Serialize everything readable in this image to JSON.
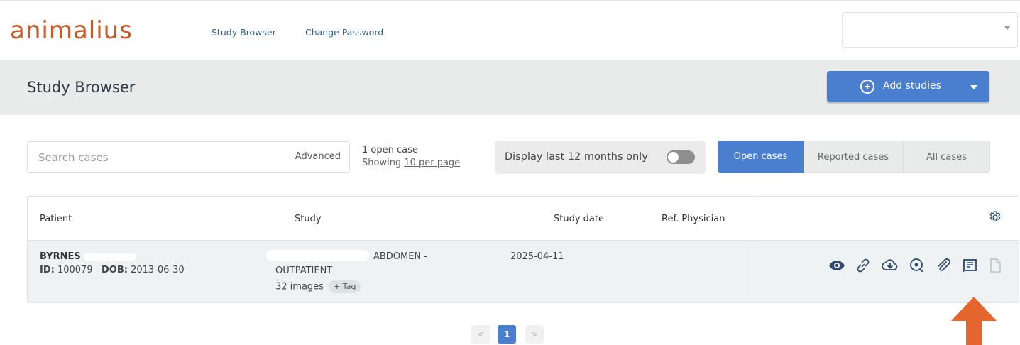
{
  "nav": {
    "logo": "animalius",
    "links": [
      "Study Browser",
      "Change Password"
    ]
  },
  "header": {
    "title": "Study Browser",
    "add_button": "Add studies"
  },
  "search": {
    "placeholder": "Search cases",
    "advanced": "Advanced"
  },
  "summary": {
    "count": "1 open case",
    "showing": "Showing ",
    "per_page": "10 per page"
  },
  "filter": {
    "toggle_label": "Display last 12 months only",
    "toggle_on": false
  },
  "segments": [
    "Open cases",
    "Reported cases",
    "All cases"
  ],
  "table": {
    "headers": [
      "Patient",
      "Study",
      "Study date",
      "Ref. Physician"
    ],
    "rows": [
      {
        "patient_name": "BYRNES",
        "id_label": "ID:",
        "id": "100079",
        "dob_label": "DOB:",
        "dob": "2013-06-30",
        "study_line1": "ABDOMEN -",
        "study_line2": "OUTPATIENT",
        "images": "32 images",
        "tag": "+ Tag",
        "date": "2025-04-11",
        "physician": ""
      }
    ]
  },
  "actions": [
    "view-icon",
    "link-icon",
    "cloud-download-icon",
    "search-image-icon",
    "attachment-icon",
    "report-icon",
    "document-icon"
  ],
  "pagination": {
    "prev": "<",
    "current": "1",
    "next": ">"
  },
  "colors": {
    "brand": "#c9592a",
    "primary": "#4a7fd0",
    "annotation": "#e4652d"
  }
}
